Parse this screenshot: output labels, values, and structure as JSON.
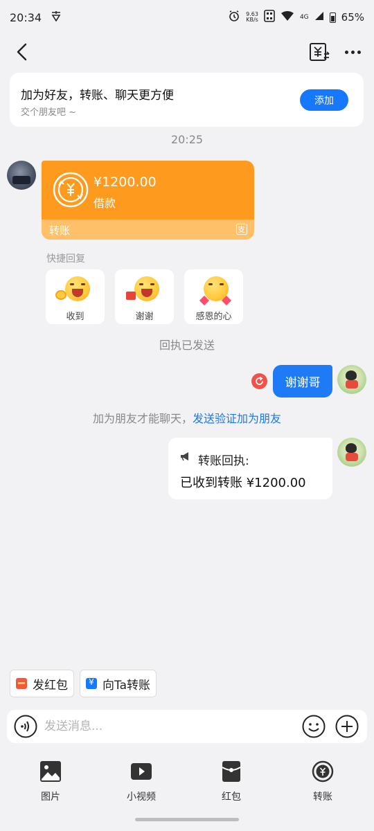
{
  "status_bar": {
    "time": "20:34",
    "net_speed_value": "9.63",
    "net_speed_unit": "KB/s",
    "network": "4G",
    "battery": "65%"
  },
  "friend_banner": {
    "title": "加为好友，转账、聊天更方便",
    "subtitle": "交个朋友吧 ~",
    "add_label": "添加"
  },
  "chat": {
    "time_label": "20:25",
    "transfer": {
      "amount": "¥1200.00",
      "note": "借款",
      "label": "转账"
    },
    "quick_reply": {
      "title": "快捷回复",
      "items": [
        {
          "label": "收到"
        },
        {
          "label": "谢谢"
        },
        {
          "label": "感恩的心"
        }
      ]
    },
    "receipt_sent_notice": "回执已发送",
    "my_message": "谢谢哥",
    "friend_notice": {
      "text": "加为朋友才能聊天，",
      "link": "发送验证加为朋友"
    },
    "receipt": {
      "title": "转账回执:",
      "body": "已收到转账 ¥1200.00"
    }
  },
  "quick_actions": [
    {
      "label": "发红包",
      "icon": "red-envelope-icon"
    },
    {
      "label": "向Ta转账",
      "icon": "transfer-icon"
    }
  ],
  "input": {
    "placeholder": "发送消息..."
  },
  "toolbar": [
    {
      "label": "图片",
      "icon": "image-icon"
    },
    {
      "label": "小视频",
      "icon": "video-icon"
    },
    {
      "label": "红包",
      "icon": "red-envelope-icon"
    },
    {
      "label": "转账",
      "icon": "transfer-icon"
    }
  ],
  "colors": {
    "accent_blue": "#1677ff",
    "transfer_orange": "#fe9a1e",
    "transfer_orange_light": "#fec068",
    "background": "#f2f2f4"
  }
}
